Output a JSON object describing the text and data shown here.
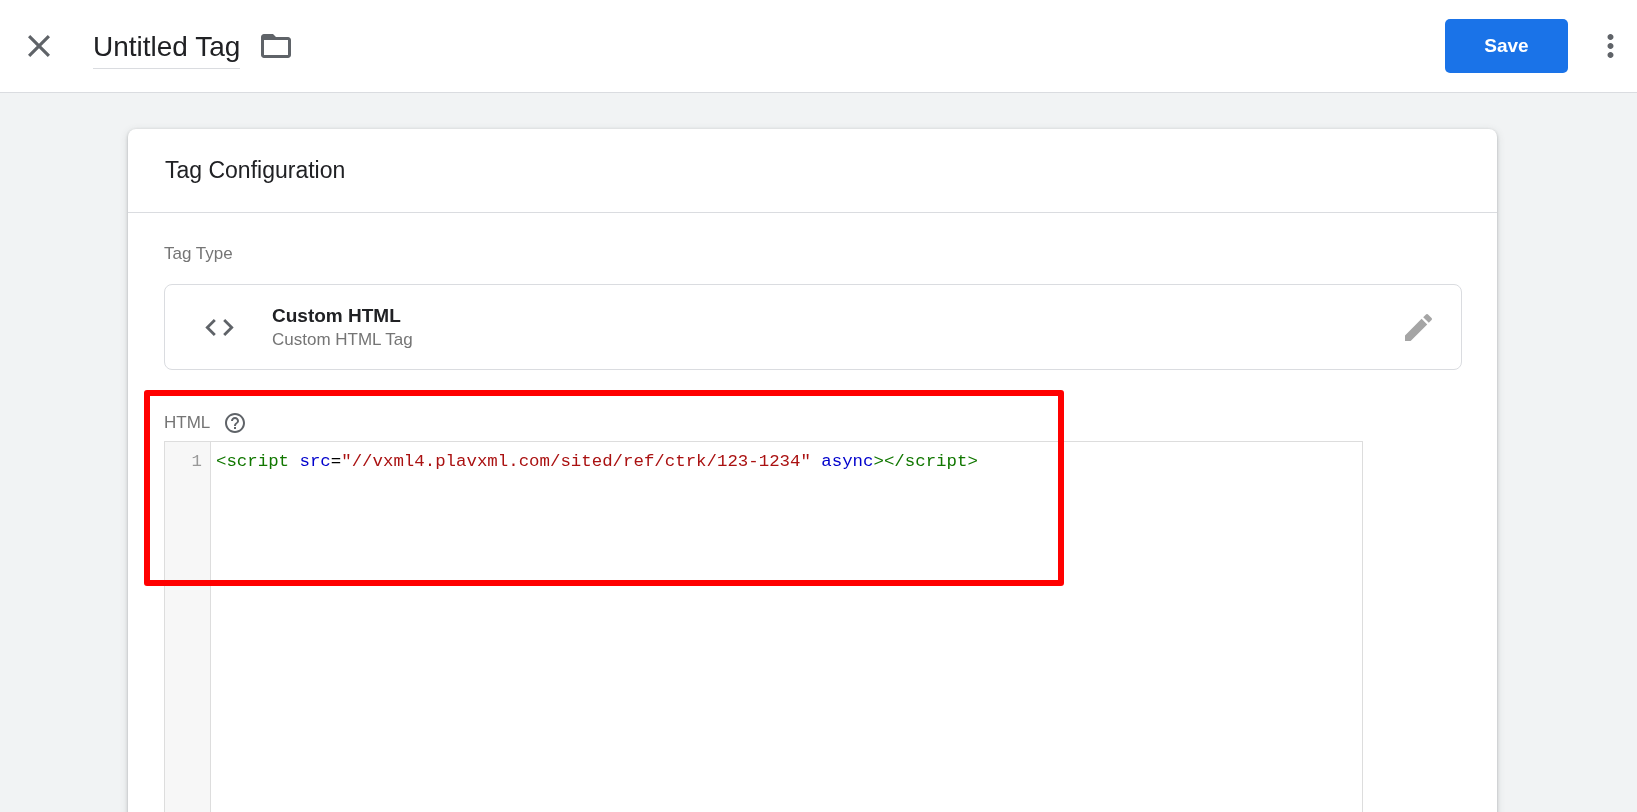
{
  "top_bar": {
    "tag_name": "Untitled Tag",
    "save_button": "Save"
  },
  "card": {
    "title": "Tag Configuration",
    "tag_type": {
      "label": "Tag Type",
      "name": "Custom HTML",
      "description": "Custom HTML Tag"
    },
    "html_field": {
      "label": "HTML",
      "lines": [
        {
          "number": "1",
          "tokens": [
            {
              "kind": "tag",
              "text": "<script"
            },
            {
              "kind": "attribute",
              "text": " src"
            },
            {
              "kind": "plain",
              "text": "="
            },
            {
              "kind": "string",
              "text": "\"//vxml4.plavxml.com/sited/ref/ctrk/123-1234\""
            },
            {
              "kind": "attribute",
              "text": " async"
            },
            {
              "kind": "tag",
              "text": "></script>"
            }
          ]
        }
      ]
    }
  }
}
